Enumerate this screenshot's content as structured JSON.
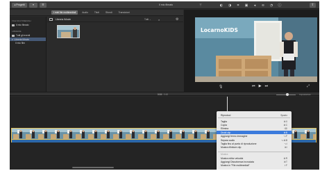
{
  "toolbar": {
    "back_label": "◂ Progetti",
    "window_title": "Il mio filmato",
    "tools": [
      "wand-icon",
      "color-balance-icon",
      "color-correction-icon",
      "crop-icon",
      "stabilization-icon",
      "volume-icon",
      "noise-reduction-icon",
      "speed-icon",
      "info-icon"
    ],
    "share_icon": "share-icon"
  },
  "tabs": [
    "I miei file multimediali",
    "Audio",
    "Titoli",
    "Sfondi",
    "Transizioni"
  ],
  "active_tab": 0,
  "sidebar": {
    "section1": "FILE MULTIMEDIALI",
    "item_project": "Il mio filmato",
    "section2": "LIBRERIE",
    "item_all_events": "Tutti gli eventi",
    "item_library": "Libreria iMovie",
    "item_event": "Il mio film"
  },
  "browser": {
    "title": "Libreria iMovie",
    "filter_label": "Tutti ⌄"
  },
  "video": {
    "logo_text": "LocarnoKIDS"
  },
  "timeline": {
    "timecode_current": "0:04",
    "timecode_total": "/ 0:48",
    "settings_label": "Impostazioni"
  },
  "context_menu": {
    "header": {
      "label": "Riproduci",
      "shortcut": "Spazio"
    },
    "items": [
      {
        "label": "Taglia",
        "shortcut": "⌘X"
      },
      {
        "label": "Copia",
        "shortcut": "⌘C"
      },
      {
        "label": "Elimina",
        "shortcut": "⌫"
      },
      {
        "label": "Dividi clip",
        "shortcut": "⌘B",
        "highlighted": true
      },
      {
        "label": "Aggiungi fermo immagine",
        "shortcut": "⌥F"
      },
      {
        "label": "Separa audio",
        "shortcut": "⌥⌘B"
      },
      {
        "label": "Taglia fino al punto di riproduzione",
        "shortcut": "⌥/"
      },
      {
        "label": "Mostra rifinitore clip",
        "shortcut": "⌘\\"
      }
    ],
    "section_label": "Mostra",
    "items2": [
      {
        "label": "Mostra editor velocità",
        "shortcut": "⌘R"
      },
      {
        "label": "Aggiungi Dissolvenza incrociata",
        "shortcut": "⌘T"
      },
      {
        "label": "Mostra in \"File multimediali\"",
        "shortcut": "⇧F"
      }
    ]
  }
}
